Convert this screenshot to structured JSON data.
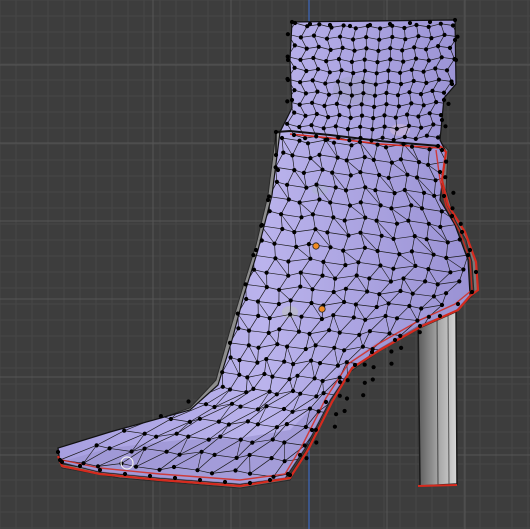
{
  "viewport": {
    "background": "#3d3d3d",
    "grid_minor_color": "#474747",
    "grid_major_color": "#555555",
    "z_axis_color": "#3b6fd6"
  },
  "mesh": {
    "object": "high-heel-ankle-boot",
    "face_color": "#b9b2ea",
    "face_shade_color": "#8f88c8",
    "edge_color": "#111111",
    "vertex_color": "#000000",
    "selected_edge_color": "#d62a1e",
    "heel_color": "#8a8a8a",
    "origin_color": "#f08a24"
  }
}
